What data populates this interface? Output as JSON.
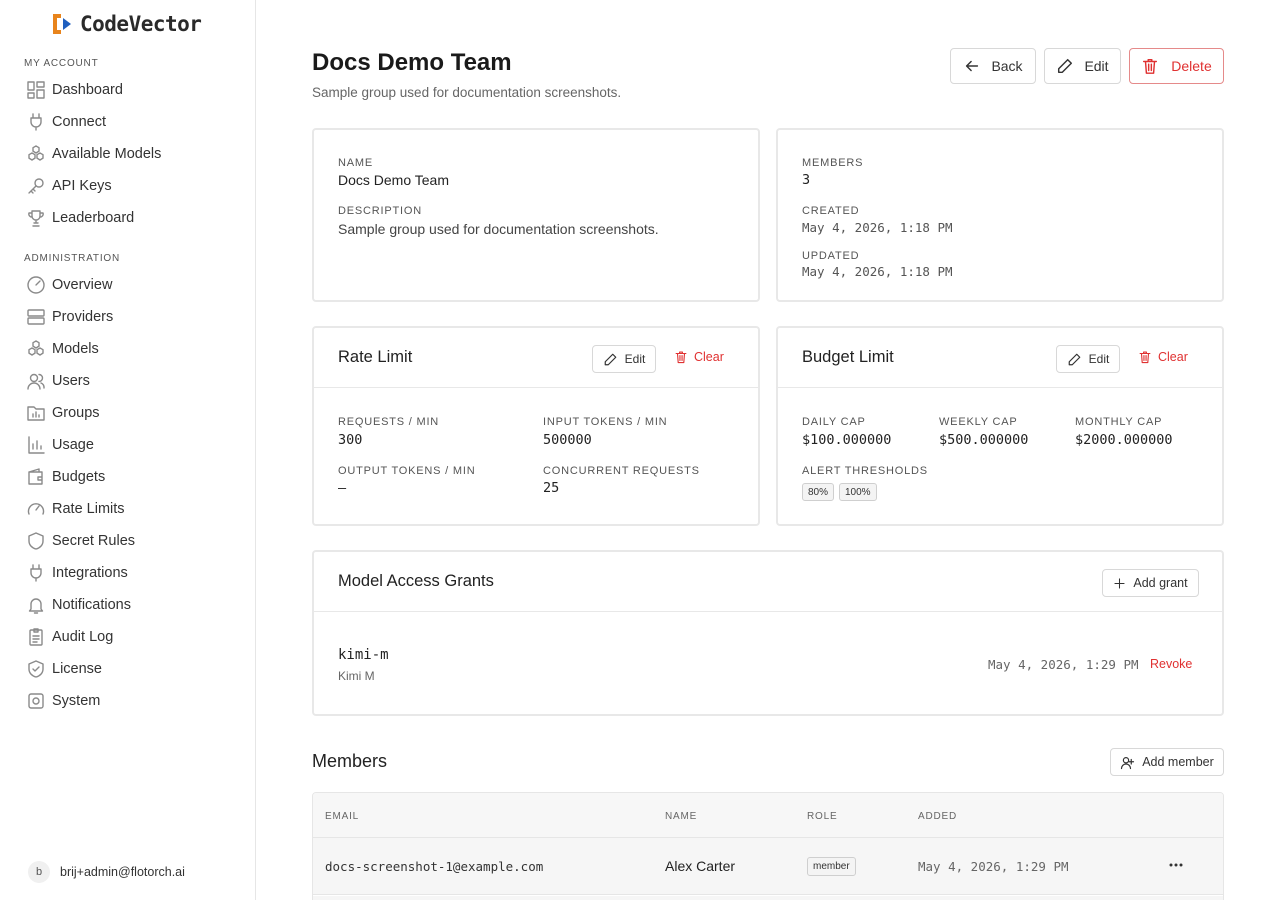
{
  "brand": {
    "name": "CodeVector",
    "colors": {
      "orange": "#e8841c",
      "blue": "#1f5fbf"
    }
  },
  "sidebar": {
    "sections": [
      {
        "title": "MY ACCOUNT",
        "items": [
          {
            "label": "Dashboard",
            "icon": "dashboard-icon"
          },
          {
            "label": "Connect",
            "icon": "plug-icon"
          },
          {
            "label": "Available Models",
            "icon": "cubes-icon"
          },
          {
            "label": "API Keys",
            "icon": "key-icon"
          },
          {
            "label": "Leaderboard",
            "icon": "trophy-icon"
          }
        ]
      },
      {
        "title": "ADMINISTRATION",
        "items": [
          {
            "label": "Overview",
            "icon": "gauge-icon"
          },
          {
            "label": "Providers",
            "icon": "server-icon"
          },
          {
            "label": "Models",
            "icon": "cubes-icon"
          },
          {
            "label": "Users",
            "icon": "users-icon"
          },
          {
            "label": "Groups",
            "icon": "folder-icon"
          },
          {
            "label": "Usage",
            "icon": "bar-chart-icon"
          },
          {
            "label": "Budgets",
            "icon": "wallet-icon"
          },
          {
            "label": "Rate Limits",
            "icon": "speedometer-icon"
          },
          {
            "label": "Secret Rules",
            "icon": "shield-icon"
          },
          {
            "label": "Integrations",
            "icon": "plug-icon"
          },
          {
            "label": "Notifications",
            "icon": "bell-icon"
          },
          {
            "label": "Audit Log",
            "icon": "clipboard-icon"
          },
          {
            "label": "License",
            "icon": "shield-check-icon"
          },
          {
            "label": "System",
            "icon": "settings-icon"
          }
        ]
      }
    ],
    "user": {
      "avatar_letter": "b",
      "email": "brij+admin@flotorch.ai"
    }
  },
  "header": {
    "title": "Docs Demo Team",
    "subtitle": "Sample group used for documentation screenshots.",
    "back_label": "Back",
    "edit_label": "Edit",
    "delete_label": "Delete"
  },
  "details": {
    "name_label": "NAME",
    "name": "Docs Demo Team",
    "description_label": "DESCRIPTION",
    "description": "Sample group used for documentation screenshots.",
    "members_label": "MEMBERS",
    "members": "3",
    "created_label": "CREATED",
    "created": "May 4, 2026, 1:18 PM",
    "updated_label": "UPDATED",
    "updated": "May 4, 2026, 1:18 PM"
  },
  "rate_limit": {
    "title": "Rate Limit",
    "edit_label": "Edit",
    "clear_label": "Clear",
    "requests_label": "REQUESTS / MIN",
    "requests": "300",
    "input_tokens_label": "INPUT TOKENS / MIN",
    "input_tokens": "500000",
    "output_tokens_label": "OUTPUT TOKENS / MIN",
    "output_tokens": "—",
    "concurrent_label": "CONCURRENT REQUESTS",
    "concurrent": "25"
  },
  "budget_limit": {
    "title": "Budget Limit",
    "edit_label": "Edit",
    "clear_label": "Clear",
    "daily_label": "DAILY CAP",
    "daily": "$100.000000",
    "weekly_label": "WEEKLY CAP",
    "weekly": "$500.000000",
    "monthly_label": "MONTHLY CAP",
    "monthly": "$2000.000000",
    "alerts_label": "ALERT THRESHOLDS",
    "alerts": [
      "80%",
      "100%"
    ]
  },
  "grants": {
    "title": "Model Access Grants",
    "add_label": "Add grant",
    "items": [
      {
        "model_id": "kimi-m",
        "model_name": "Kimi M",
        "date": "May 4, 2026, 1:29 PM",
        "revoke_label": "Revoke"
      }
    ]
  },
  "members": {
    "title": "Members",
    "add_label": "Add member",
    "columns": [
      "EMAIL",
      "NAME",
      "ROLE",
      "ADDED"
    ],
    "rows": [
      {
        "email": "docs-screenshot-1@example.com",
        "name": "Alex Carter",
        "role": "member",
        "added": "May 4, 2026, 1:29 PM"
      }
    ]
  }
}
